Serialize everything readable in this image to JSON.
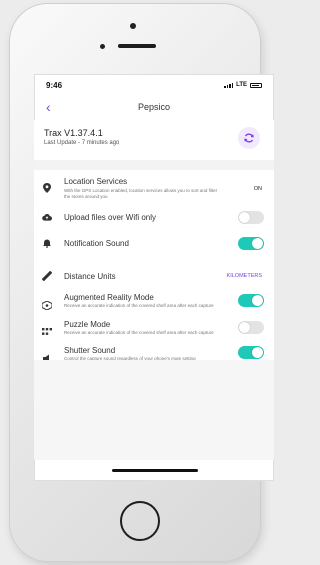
{
  "status": {
    "time": "9:46",
    "network": "LTE"
  },
  "nav": {
    "title": "Pepsico"
  },
  "app": {
    "version": "Trax V1.37.4.1",
    "last_update": "Last Update - 7 minutes ago"
  },
  "settings": [
    {
      "id": "location",
      "label": "Location Services",
      "subtitle": "With the GPS Location enabled, location services allows you to sort and filter the stores around you",
      "value": "ON",
      "icon": "location-pin-icon"
    },
    {
      "id": "wifi",
      "label": "Upload files over Wifi only",
      "toggle": false,
      "icon": "cloud-upload-icon"
    },
    {
      "id": "sound",
      "label": "Notification Sound",
      "toggle": true,
      "icon": "bell-icon"
    },
    {
      "id": "units",
      "label": "Distance Units",
      "value": "KILOMETERS",
      "icon": "ruler-icon"
    },
    {
      "id": "ar",
      "label": "Augmented Reality Mode",
      "subtitle": "Receive an accurate indication of the covered shelf area after each capture",
      "toggle": true,
      "icon": "ar-cube-icon"
    },
    {
      "id": "puzzle",
      "label": "Puzzle Mode",
      "subtitle": "Receive an accurate indication of the covered shelf area after each capture",
      "toggle": false,
      "icon": "grid-icon"
    },
    {
      "id": "shutter",
      "label": "Shutter Sound",
      "subtitle": "Control the capture sound regardless of your phone's mute setting",
      "toggle": true,
      "icon": "speaker-icon"
    }
  ],
  "colors": {
    "accent": "#7b3fe4",
    "toggle_on": "#1fc9b8",
    "toggle_off": "#e3e3e3"
  }
}
